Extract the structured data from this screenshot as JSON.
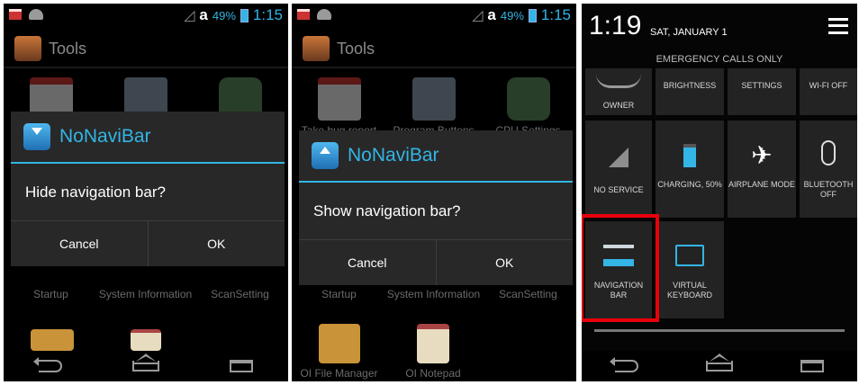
{
  "status_left": {
    "carrier_letter": "a",
    "battery_pct": "49%",
    "time": "1:15"
  },
  "app": {
    "title": "Tools"
  },
  "grid_top": [
    {
      "label": "Take bug report"
    },
    {
      "label": "Program Buttons"
    },
    {
      "label": "CPU Settings"
    }
  ],
  "grid_mid": [
    {
      "label": "Startup"
    },
    {
      "label": "System Information"
    },
    {
      "label": "ScanSetting"
    }
  ],
  "grid_bottom": [
    {
      "label": "OI File Manager"
    },
    {
      "label": "OI Notepad"
    }
  ],
  "dialog_hide": {
    "title": "NoNaviBar",
    "message": "Hide navigation bar?",
    "cancel": "Cancel",
    "ok": "OK"
  },
  "dialog_show": {
    "title": "NoNaviBar",
    "message": "Show navigation bar?",
    "cancel": "Cancel",
    "ok": "OK"
  },
  "quick_settings": {
    "time": "1:19",
    "date": "SAT, JANUARY 1",
    "emergency": "EMERGENCY CALLS ONLY",
    "tiles": [
      {
        "label": "OWNER"
      },
      {
        "label": "BRIGHTNESS"
      },
      {
        "label": "SETTINGS"
      },
      {
        "label": "WI-FI OFF"
      },
      {
        "label": "NO SERVICE"
      },
      {
        "label": "CHARGING, 50%"
      },
      {
        "label": "AIRPLANE MODE"
      },
      {
        "label": "BLUETOOTH OFF"
      },
      {
        "label": "NAVIGATION BAR"
      },
      {
        "label": "VIRTUAL KEYBOARD"
      }
    ]
  },
  "colors": {
    "accent": "#33b5e5",
    "highlight": "#e8000b",
    "dialog_bg": "#282828"
  }
}
